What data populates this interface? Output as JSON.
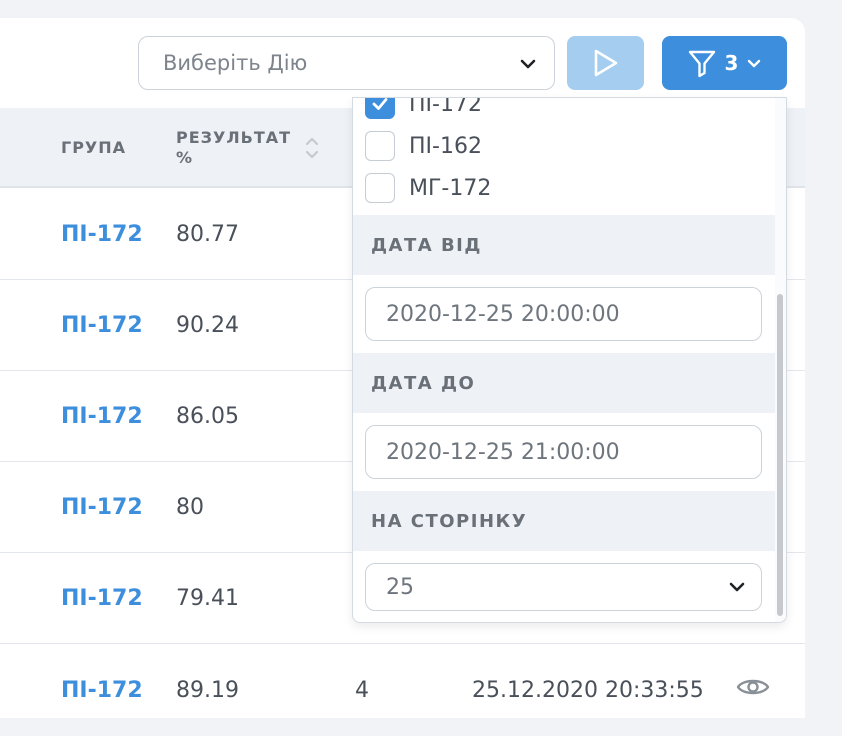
{
  "toolbar": {
    "action_placeholder": "Виберіть Дію",
    "filter_count": "3"
  },
  "table": {
    "headers": {
      "group": "ГРУПА",
      "result": "РЕЗУЛЬТАТ %"
    },
    "rows": [
      {
        "group": "ПІ-172",
        "result": "80.77"
      },
      {
        "group": "ПІ-172",
        "result": "90.24"
      },
      {
        "group": "ПІ-172",
        "result": "86.05"
      },
      {
        "group": "ПІ-172",
        "result": "80"
      },
      {
        "group": "ПІ-172",
        "result": "79.41"
      },
      {
        "group": "ПІ-172",
        "result": "89.19",
        "count": "4",
        "date": "25.12.2020 20:33:55"
      }
    ]
  },
  "filters": {
    "groups": [
      {
        "label": "ПІ-172",
        "checked": true
      },
      {
        "label": "ПІ-162",
        "checked": false
      },
      {
        "label": "МГ-172",
        "checked": false
      }
    ],
    "date_from_label": "ДАТА ВІД",
    "date_from_value": "2020-12-25 20:00:00",
    "date_to_label": "ДАТА ДО",
    "date_to_value": "2020-12-25 21:00:00",
    "per_page_label": "НА СТОРІНКУ",
    "per_page_value": "25"
  },
  "colors": {
    "accent": "#3d8fdd",
    "accent_disabled": "#a5cdef",
    "header_bg": "#eef1f5"
  },
  "icons": [
    "chevron-down-icon",
    "play-icon",
    "filter-icon",
    "sort-icon",
    "check-icon",
    "eye-icon"
  ]
}
